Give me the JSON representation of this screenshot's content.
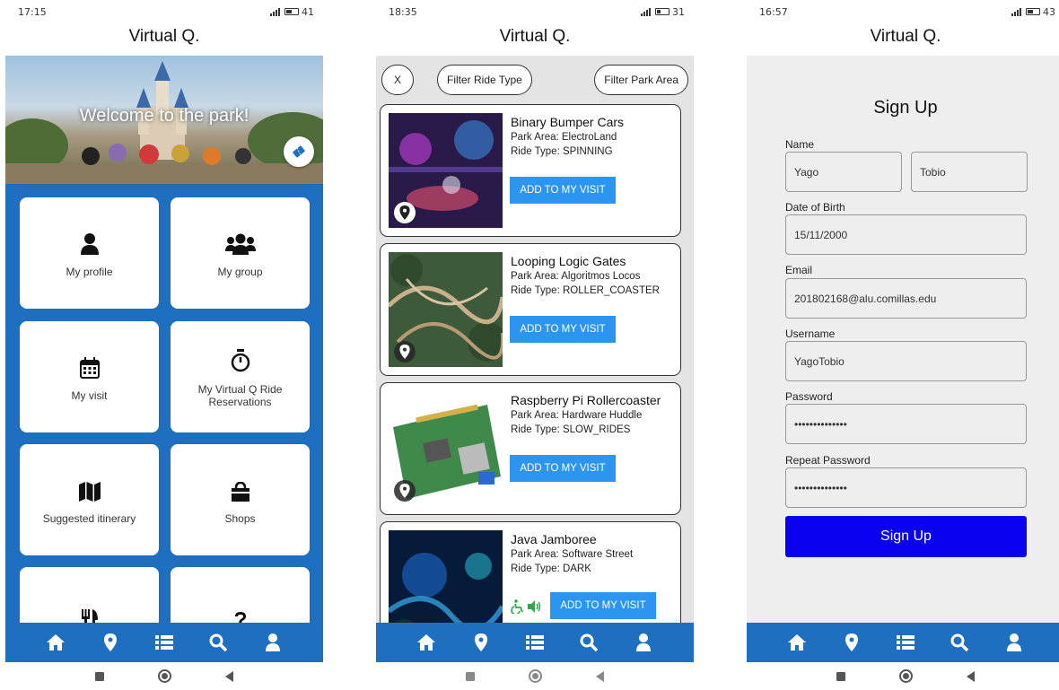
{
  "app_title": "Virtual Q.",
  "colors": {
    "primary": "#1f6fc1",
    "add_button": "#2b95f0",
    "signup_button": "#0a00f0",
    "accessibility": "#2ea84a"
  },
  "bottom_nav_icons": [
    "home-icon",
    "map-pin-icon",
    "list-icon",
    "search-icon",
    "user-icon"
  ],
  "screens": {
    "home": {
      "status_time": "17:15",
      "battery": "41",
      "welcome": "Welcome to the park!",
      "tiles": [
        {
          "label": "My profile",
          "icon": "user-icon"
        },
        {
          "label": "My group",
          "icon": "group-icon"
        },
        {
          "label": "My visit",
          "icon": "calendar-icon"
        },
        {
          "label": "My Virtual Q Ride Reservations",
          "icon": "stopwatch-icon"
        },
        {
          "label": "Suggested itinerary",
          "icon": "map-icon"
        },
        {
          "label": "Shops",
          "icon": "shopping-bag-icon"
        },
        {
          "label": "",
          "icon": "restaurant-icon"
        },
        {
          "label": "",
          "icon": "question-icon"
        }
      ]
    },
    "rides": {
      "status_time": "18:35",
      "battery": "31",
      "filters": {
        "clear": "X",
        "ride_type": "Filter Ride Type",
        "park_area": "Filter Park Area"
      },
      "add_label": "ADD TO MY VISIT",
      "rides": [
        {
          "name": "Binary Bumper Cars",
          "area": "Park Area: ElectroLand",
          "type": "Ride Type: SPINNING"
        },
        {
          "name": "Looping Logic Gates",
          "area": "Park Area: Algoritmos Locos",
          "type": "Ride Type: ROLLER_COASTER"
        },
        {
          "name": "Raspberry Pi Rollercoaster",
          "area": "Park Area: Hardware Huddle",
          "type": "Ride Type: SLOW_RIDES"
        },
        {
          "name": "Java Jamboree",
          "area": "Park Area: Software Street",
          "type": "Ride Type: DARK"
        }
      ]
    },
    "signup": {
      "status_time": "16:57",
      "battery": "43",
      "title": "Sign Up",
      "labels": {
        "name": "Name",
        "dob": "Date of Birth",
        "email": "Email",
        "username": "Username",
        "password": "Password",
        "repeat": "Repeat Password"
      },
      "values": {
        "first_name": "Yago",
        "last_name": "Tobio",
        "dob": "15/11/2000",
        "email": "201802168@alu.comillas.edu",
        "username": "YagoTobio",
        "password": "••••••••••••••",
        "repeat": "••••••••••••••"
      },
      "button": "Sign Up"
    }
  }
}
